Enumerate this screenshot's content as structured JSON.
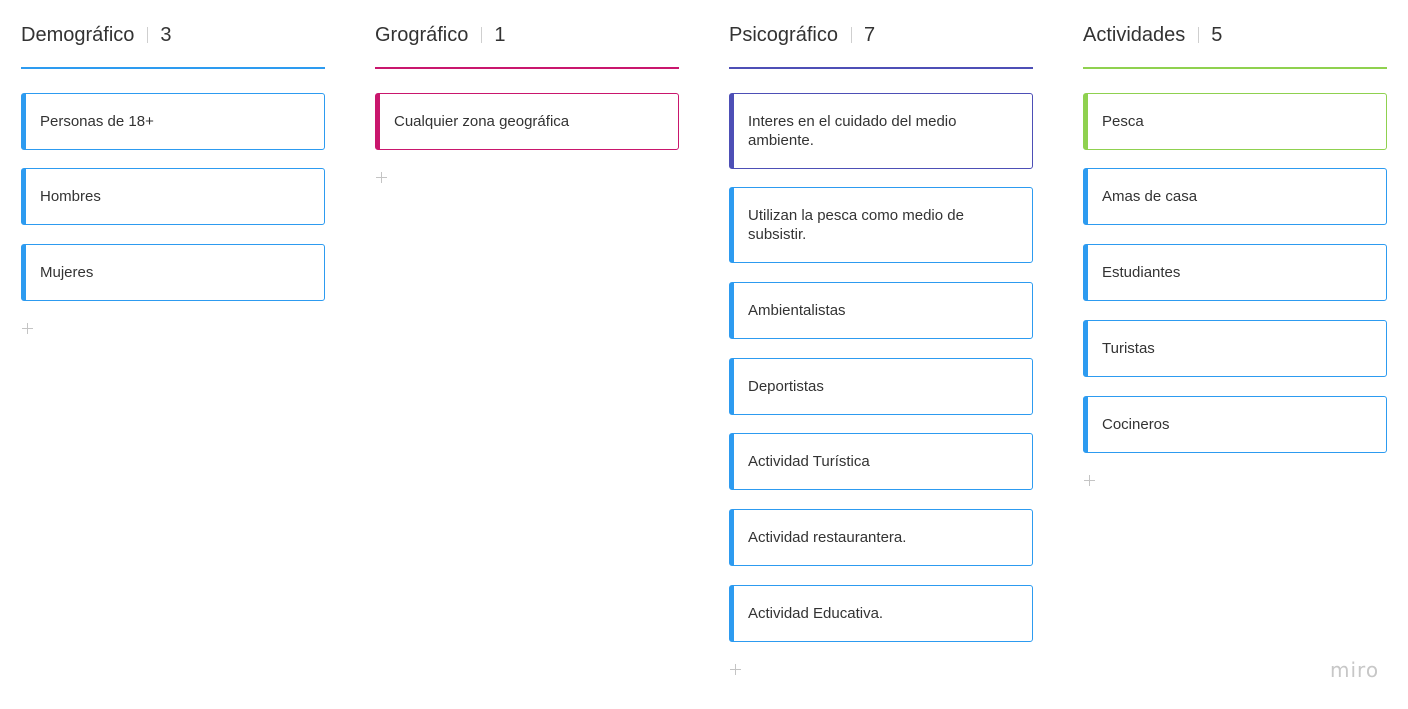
{
  "colors": {
    "blue": "#2d9bf0",
    "magenta": "#c9166d",
    "indigo": "#4d4fb6",
    "green": "#8fd14f",
    "text": "#333333",
    "muted": "#c4c4c4"
  },
  "columns": [
    {
      "title": "Demográfico",
      "count": "3",
      "cards": [
        "Personas de 18+",
        "Hombres",
        "Mujeres"
      ]
    },
    {
      "title": "Grográfico",
      "count": "1",
      "cards": [
        "Cualquier zona geográfica"
      ]
    },
    {
      "title": "Psicográfico",
      "count": "7",
      "cards": [
        "Interes en el cuidado del medio ambiente.",
        "Utilizan la pesca como medio de subsistir.",
        "Ambientalistas",
        "Deportistas",
        "Actividad Turística",
        "Actividad restaurantera.",
        "Actividad Educativa."
      ]
    },
    {
      "title": "Actividades",
      "count": "5",
      "cards": [
        "Pesca",
        "Amas de casa",
        "Estudiantes",
        "Turistas",
        "Cocineros"
      ]
    }
  ],
  "icons": {
    "add": "plus-icon"
  },
  "branding": {
    "logo_text": "miro"
  }
}
